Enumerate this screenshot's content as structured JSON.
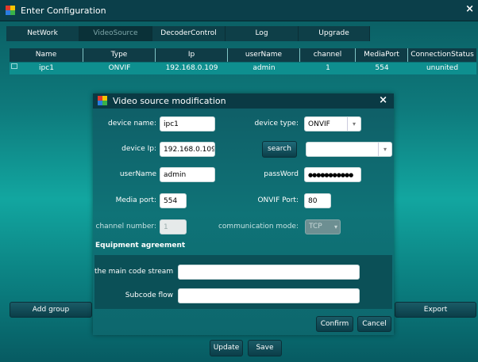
{
  "window": {
    "title": "Enter Configuration",
    "close": "×"
  },
  "tabs": [
    {
      "label": "NetWork"
    },
    {
      "label": "VideoSource"
    },
    {
      "label": "DecoderControl"
    },
    {
      "label": "Log"
    },
    {
      "label": "Upgrade"
    }
  ],
  "table": {
    "columns": [
      "Name",
      "Type",
      "Ip",
      "userName",
      "channel",
      "MediaPort",
      "ConnectionStatus"
    ],
    "rows": [
      [
        "ipc1",
        "ONVIF",
        "192.168.0.109",
        "admin",
        "1",
        "554",
        "ununited"
      ]
    ]
  },
  "side_buttons": {
    "add_group": "Add group",
    "export": "Export"
  },
  "bottom_buttons": {
    "update": "Update",
    "save": "Save"
  },
  "dialog": {
    "title": "Video source modification",
    "close": "×",
    "device_name": {
      "label": "device name:",
      "value": "ipc1"
    },
    "device_type": {
      "label": "device type:",
      "value": "ONVIF"
    },
    "device_ip": {
      "label": "device Ip:",
      "value": "192.168.0.109"
    },
    "search_button": "search",
    "search_result": {
      "value": ""
    },
    "username": {
      "label": "userName",
      "value": "admin"
    },
    "password": {
      "label": "passWord",
      "value": "●●●●●●●●●●●"
    },
    "media_port": {
      "label": "Media port:",
      "value": "554"
    },
    "onvif_port": {
      "label": "ONVIF Port:",
      "value": "80"
    },
    "channel_number": {
      "label": "channel number:",
      "value": "1"
    },
    "communication_mode": {
      "label": "communication mode:",
      "value": "TCP"
    },
    "section_title": "Equipment agreement",
    "main_stream": {
      "label": "the main code stream",
      "value": ""
    },
    "sub_stream": {
      "label": "Subcode flow",
      "value": ""
    },
    "confirm": "Confirm",
    "cancel": "Cancel"
  }
}
